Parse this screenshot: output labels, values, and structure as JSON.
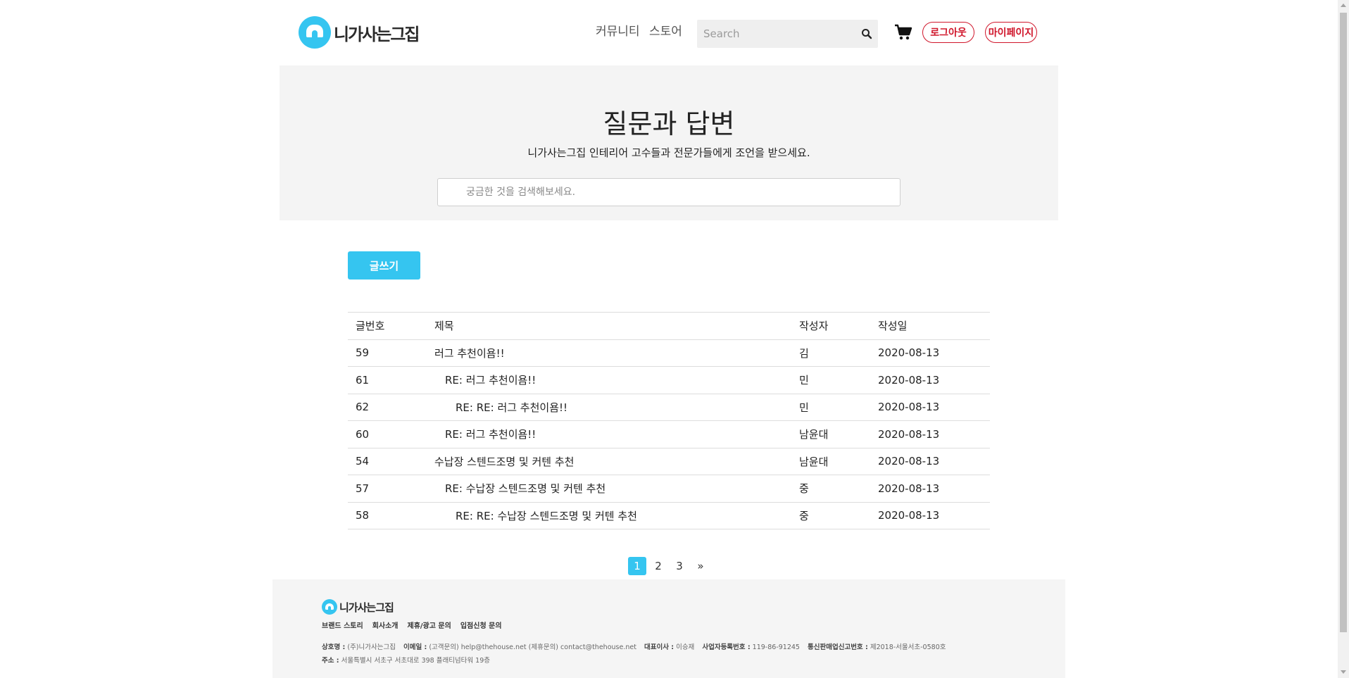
{
  "header": {
    "logo_text": "니가사는그집",
    "nav": {
      "community": "커뮤니티",
      "store": "스토어"
    },
    "search_placeholder": "Search",
    "logout_label": "로그아웃",
    "mypage_label": "마이페이지"
  },
  "hero": {
    "title": "질문과 답변",
    "subtitle": "니가사는그집 인테리어 고수들과 전문가들에게 조언을 받으세요.",
    "search_placeholder": "궁금한 것을 검색해보세요."
  },
  "write_button_label": "글쓰기",
  "table": {
    "headers": {
      "no": "글번호",
      "title": "제목",
      "author": "작성자",
      "date": "작성일"
    },
    "rows": [
      {
        "no": "59",
        "title": "러그 추천이욤!!",
        "author": "김",
        "date": "2020-08-13",
        "depth": 0
      },
      {
        "no": "61",
        "title": "RE: 러그 추천이욤!!",
        "author": "민",
        "date": "2020-08-13",
        "depth": 1
      },
      {
        "no": "62",
        "title": "RE: RE: 러그 추천이욤!!",
        "author": "민",
        "date": "2020-08-13",
        "depth": 2
      },
      {
        "no": "60",
        "title": "RE: 러그 추천이욤!!",
        "author": "남윤대",
        "date": "2020-08-13",
        "depth": 1
      },
      {
        "no": "54",
        "title": "수납장 스텐드조명 및 커텐 추천",
        "author": "남윤대",
        "date": "2020-08-13",
        "depth": 0
      },
      {
        "no": "57",
        "title": "RE: 수납장 스텐드조명 및 커텐 추천",
        "author": "중",
        "date": "2020-08-13",
        "depth": 1
      },
      {
        "no": "58",
        "title": "RE: RE: 수납장 스텐드조명 및 커텐 추천",
        "author": "중",
        "date": "2020-08-13",
        "depth": 2
      }
    ]
  },
  "pagination": {
    "pages": [
      "1",
      "2",
      "3"
    ],
    "next": "»",
    "current": "1"
  },
  "footer": {
    "logo_text": "니가사는그집",
    "links": [
      "브랜드 스토리",
      "회사소개",
      "제휴/광고 문의",
      "입점신청 문의"
    ],
    "company_label": "상호명 :",
    "company_value": "(주)니가사는그집",
    "email_label": "이메일 :",
    "email_value": "(고객문의) help@thehouse.net (제휴문의) contact@thehouse.net",
    "ceo_label": "대표이사 :",
    "ceo_value": "이승재",
    "bizno_label": "사업자등록번호 :",
    "bizno_value": "119-86-91245",
    "telecom_label": "통신판매업신고번호 :",
    "telecom_value": "제2018-서울서초-0580호",
    "address_label": "주소 :",
    "address_value": "서울특별시 서초구 서초대로 398 플래티넘타워 19층"
  },
  "colors": {
    "accent": "#35c5f0",
    "danger": "#d0162b"
  }
}
